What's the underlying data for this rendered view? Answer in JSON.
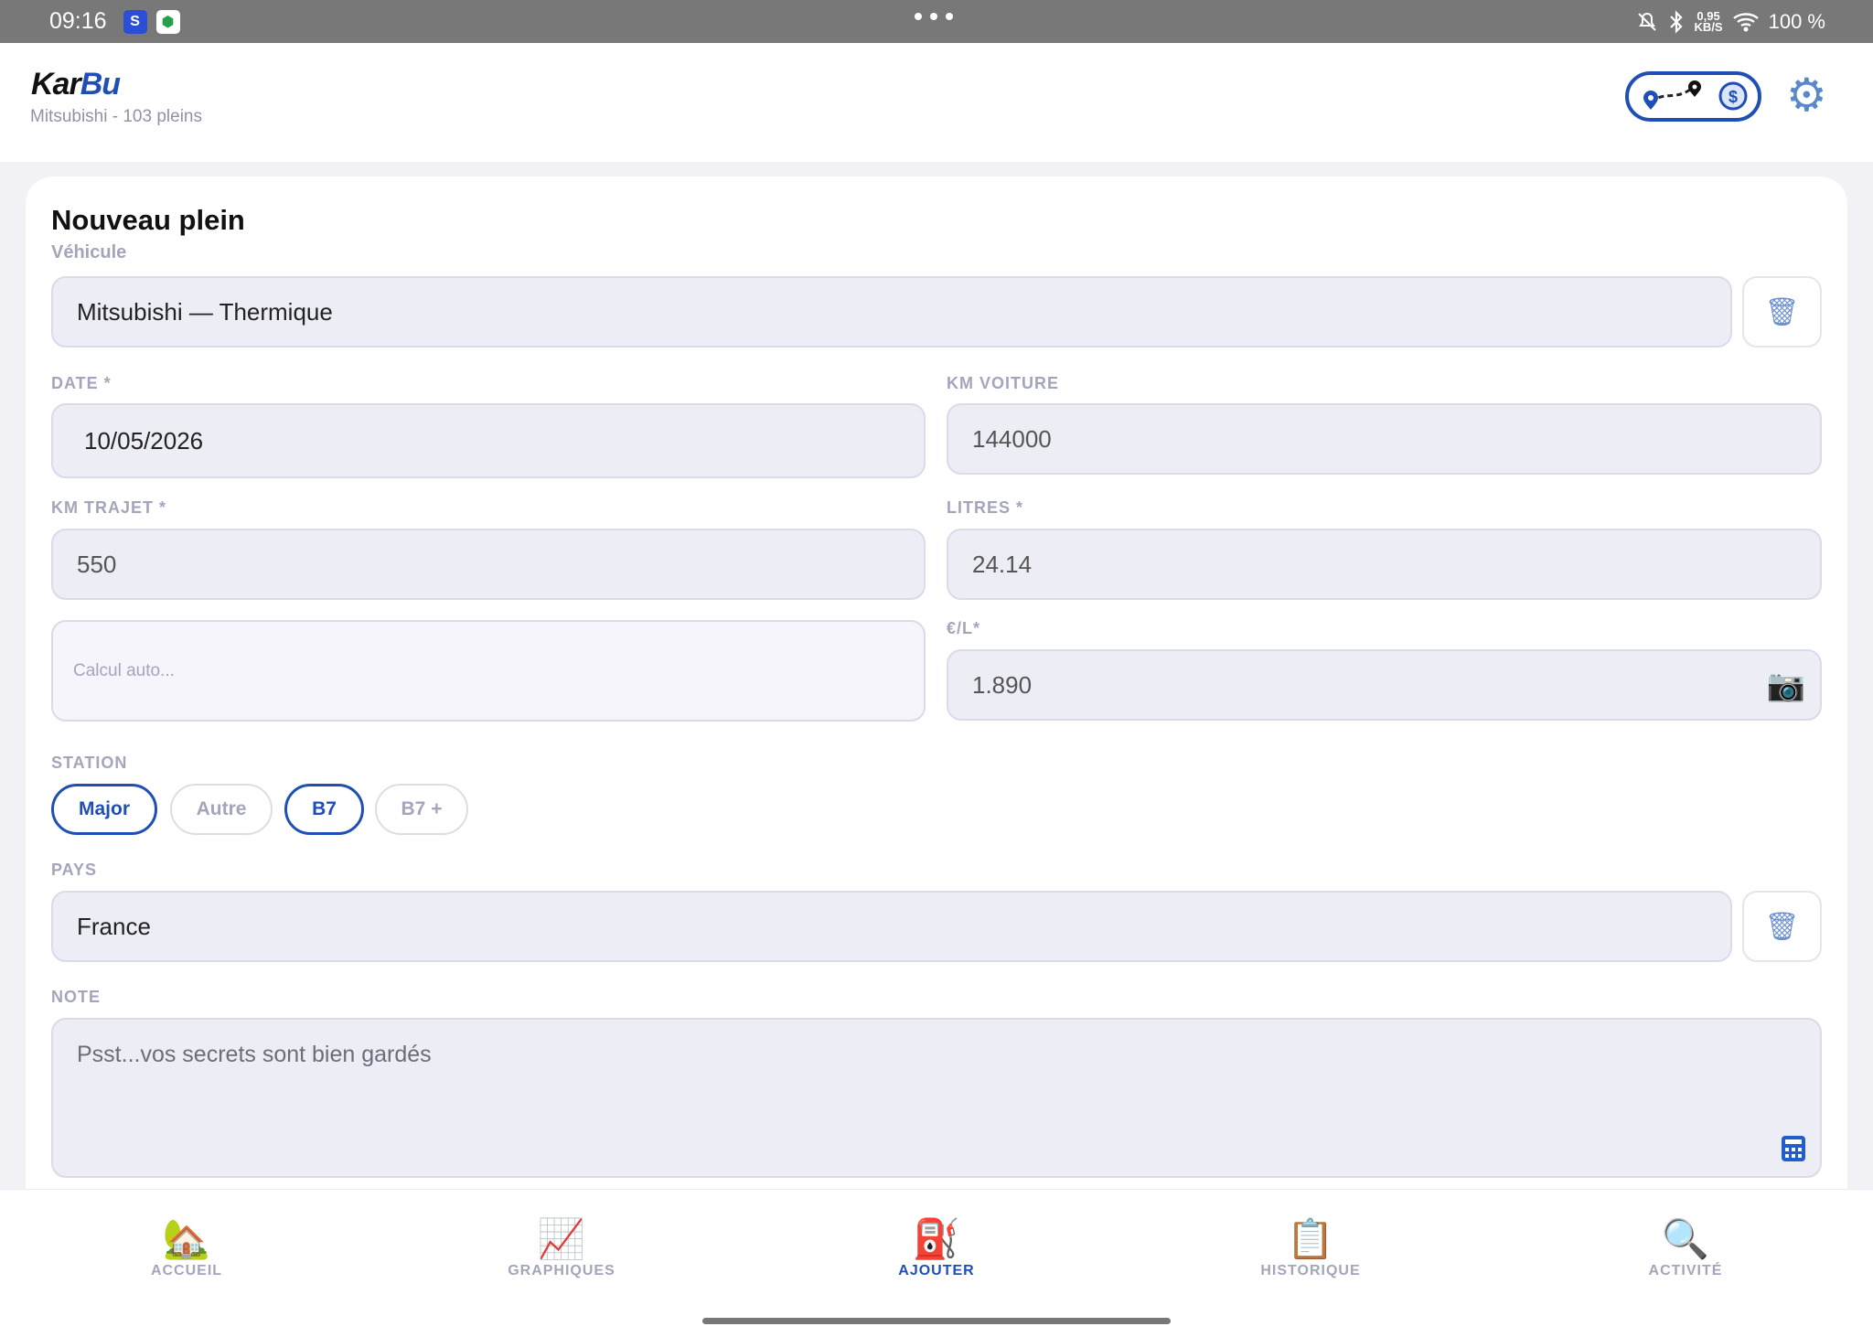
{
  "status_bar": {
    "time": "09:16",
    "app_icon_1": "S",
    "app_icon_2": "⬢",
    "speed_value": "0,95",
    "speed_unit": "KB/S",
    "battery": "100 %",
    "icons": [
      "notifications-off-icon",
      "bluetooth-icon",
      "wifi-icon"
    ]
  },
  "header": {
    "logo_part1": "Kar",
    "logo_part2": "Bu",
    "subtitle": "Mitsubishi - 103 pleins",
    "toggle_icons": [
      "route-icon",
      "dollar-icon"
    ],
    "settings_icon": "gear-icon"
  },
  "form": {
    "title": "Nouveau plein",
    "vehicle_label": "Véhicule",
    "vehicle_value": "Mitsubishi — Thermique",
    "date_label": "DATE *",
    "date_value": "10/05/2026",
    "km_voiture_label": "KM VOITURE",
    "km_voiture_value": "144000",
    "km_trajet_label": "KM TRAJET *",
    "km_trajet_value": "550",
    "litres_label": "LITRES *",
    "litres_value": "24.14",
    "calc_placeholder": "Calcul auto...",
    "prix_label": "€/L*",
    "prix_value": "1.890",
    "station_label": "STATION",
    "stations": [
      {
        "label": "Major",
        "active": true
      },
      {
        "label": "Autre",
        "active": false
      },
      {
        "label": "B7",
        "active": true
      },
      {
        "label": "B7 +",
        "active": false
      }
    ],
    "pays_label": "PAYS",
    "pays_value": "France",
    "note_label": "NOTE",
    "note_placeholder": "Psst...vos secrets sont bien gardés"
  },
  "bottom_nav": [
    {
      "label": "ACCUEIL",
      "icon": "🏡",
      "active": false
    },
    {
      "label": "GRAPHIQUES",
      "icon": "📈",
      "active": false
    },
    {
      "label": "AJOUTER",
      "icon": "⛽",
      "active": true
    },
    {
      "label": "HISTORIQUE",
      "icon": "📋",
      "active": false
    },
    {
      "label": "ACTIVITÉ",
      "icon": "🔍",
      "active": false
    }
  ],
  "colors": {
    "accent": "#1f4fb5",
    "field_bg": "#ededf6",
    "label": "#a3a6bb"
  }
}
